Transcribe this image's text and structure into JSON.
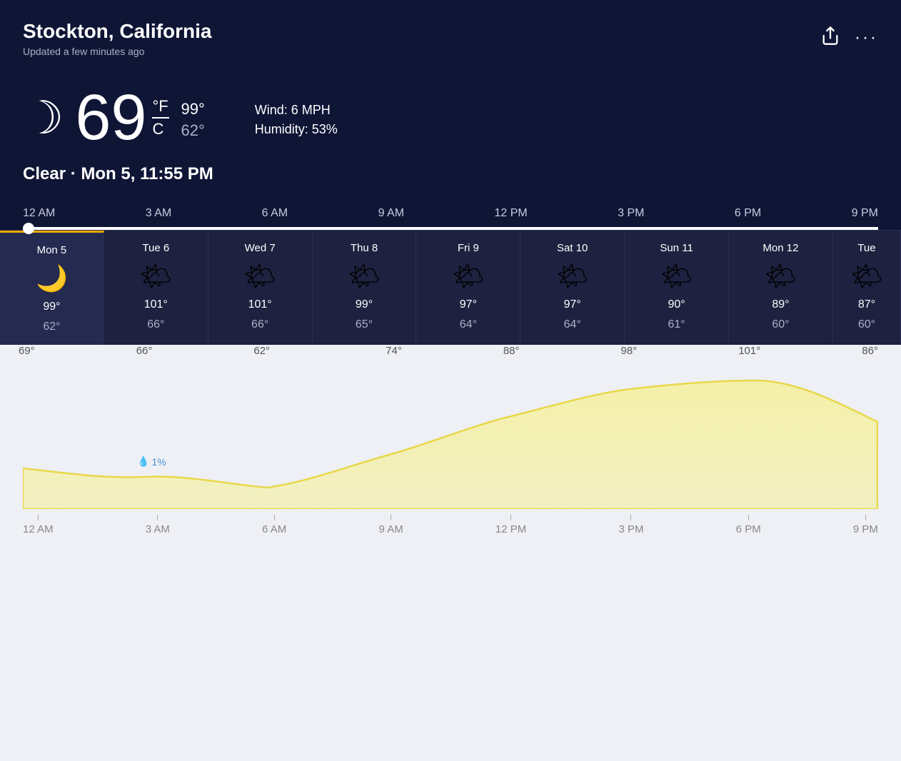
{
  "header": {
    "city": "Stockton, California",
    "updated": "Updated a few minutes ago",
    "share_label": "share",
    "more_label": "more"
  },
  "current": {
    "temp": "69",
    "unit_f": "°F",
    "unit_c": "C",
    "high": "99°",
    "low": "62°",
    "wind": "Wind: 6 MPH",
    "humidity": "Humidity: 53%",
    "condition": "Clear",
    "datetime": "Mon 5, 11:55 PM"
  },
  "time_slider": {
    "labels": [
      "12 AM",
      "3 AM",
      "6 AM",
      "9 AM",
      "12 PM",
      "3 PM",
      "6 PM",
      "9 PM"
    ]
  },
  "forecast": [
    {
      "day": "Mon 5",
      "high": "99°",
      "low": "62°",
      "icon": "moon",
      "active": true
    },
    {
      "day": "Tue 6",
      "high": "101°",
      "low": "66°",
      "icon": "sun",
      "active": false
    },
    {
      "day": "Wed 7",
      "high": "101°",
      "low": "66°",
      "icon": "sun",
      "active": false
    },
    {
      "day": "Thu 8",
      "high": "99°",
      "low": "65°",
      "icon": "sun",
      "active": false
    },
    {
      "day": "Fri 9",
      "high": "97°",
      "low": "64°",
      "icon": "sun",
      "active": false
    },
    {
      "day": "Sat 10",
      "high": "97°",
      "low": "64°",
      "icon": "sun",
      "active": false
    },
    {
      "day": "Sun 11",
      "high": "90°",
      "low": "61°",
      "icon": "sun",
      "active": false
    },
    {
      "day": "Mon 12",
      "high": "89°",
      "low": "60°",
      "icon": "sun",
      "active": false
    },
    {
      "day": "Tue",
      "high": "87°",
      "low": "60°",
      "icon": "sun",
      "active": false,
      "partial": true
    }
  ],
  "chart": {
    "temps": [
      69,
      66,
      62,
      74,
      88,
      98,
      101,
      86
    ],
    "labels": [
      "69°",
      "66°",
      "62°",
      "74°",
      "88°",
      "98°",
      "101°",
      "86°"
    ],
    "time_labels": [
      "12 AM",
      "3 AM",
      "6 AM",
      "9 AM",
      "12 PM",
      "3 PM",
      "6 PM",
      "9 PM"
    ],
    "rain_percent": "1%"
  }
}
